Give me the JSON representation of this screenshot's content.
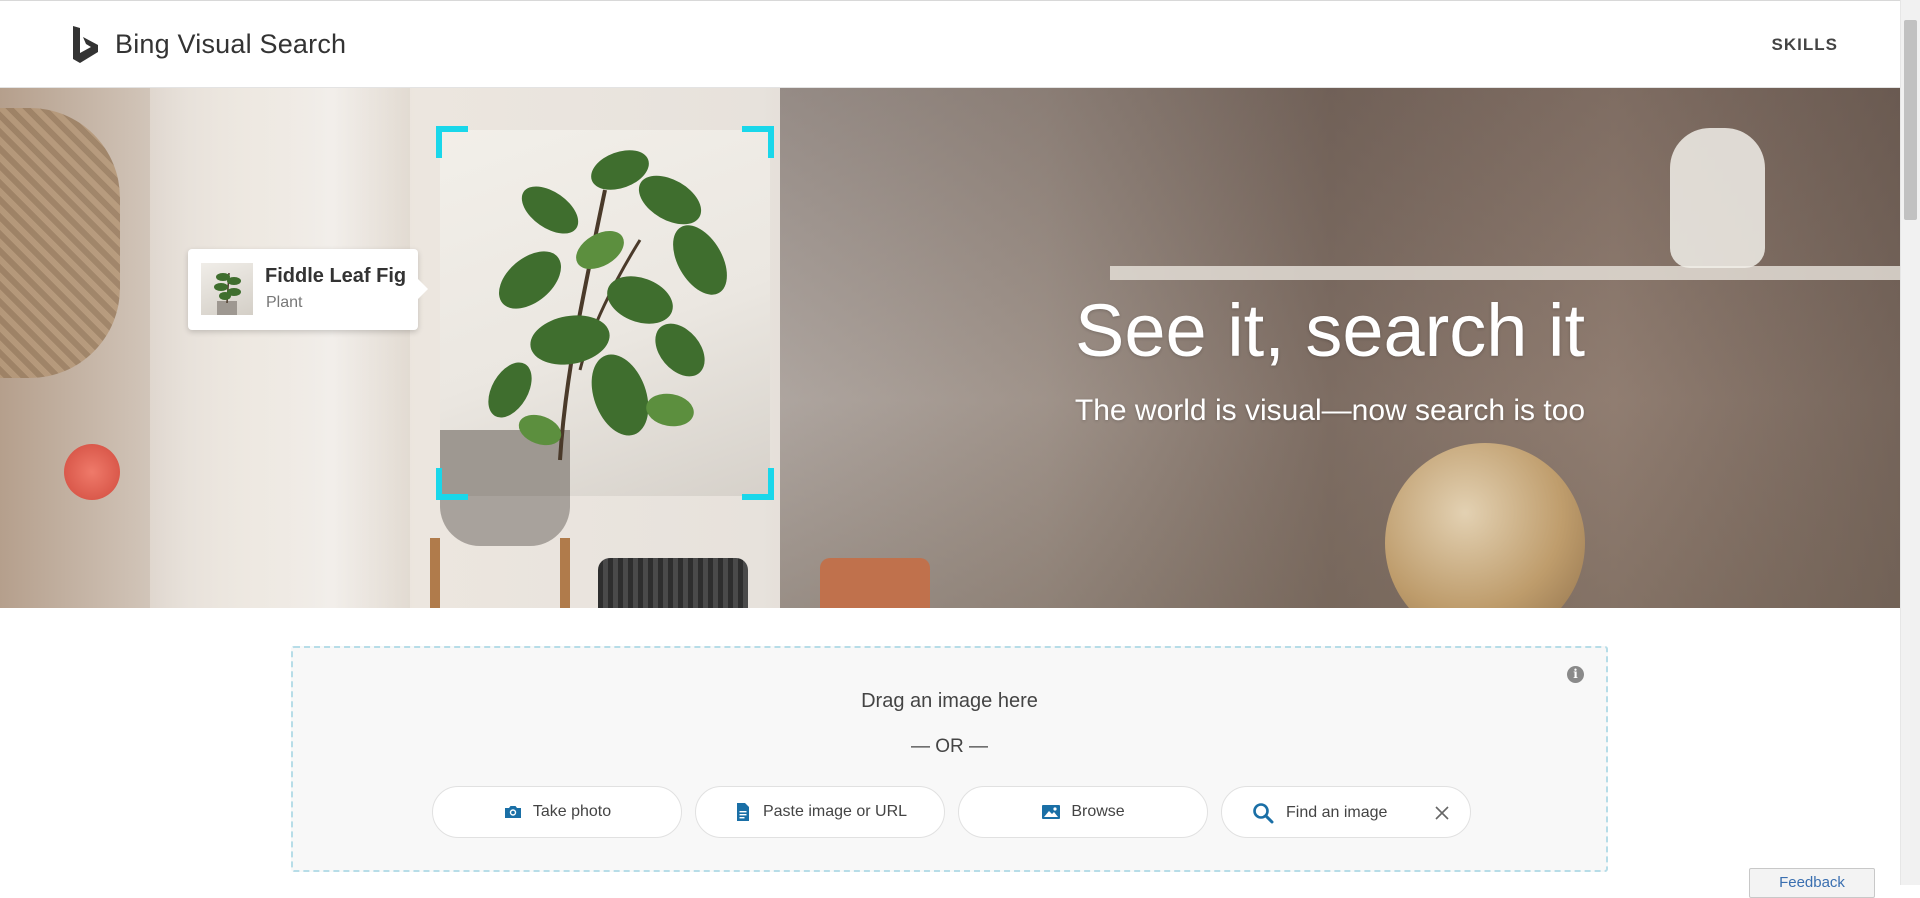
{
  "header": {
    "logo_icon": "bing-b-logo-icon",
    "title": "Bing Visual Search",
    "nav": {
      "skills_label": "SKILLS"
    }
  },
  "hero": {
    "headline": "See it, search it",
    "subheadline": "The world is visual—now search is too",
    "result_card": {
      "name": "Fiddle Leaf Fig",
      "category": "Plant"
    },
    "selection_color": "#19d7ea"
  },
  "upload": {
    "drag_label": "Drag an image here",
    "or_label": "— OR —",
    "take_photo_label": "Take photo",
    "paste_label": "Paste image or URL",
    "browse_label": "Browse",
    "search_placeholder": "Find an image",
    "info_icon_glyph": "i"
  },
  "feedback_label": "Feedback",
  "colors": {
    "accent": "#19d7ea",
    "icon_blue": "#1a6fa6",
    "panel_border": "#b7dde8"
  }
}
